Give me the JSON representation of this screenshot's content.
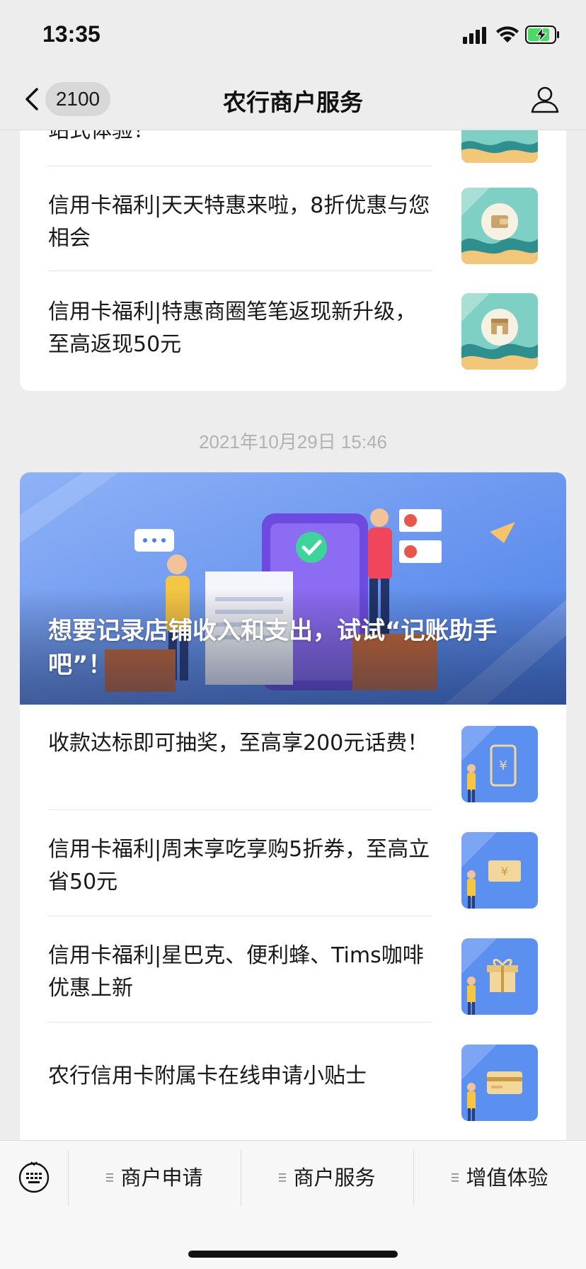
{
  "status_bar": {
    "time": "13:35"
  },
  "nav": {
    "unread_count": "2100",
    "title": "农行商户服务"
  },
  "top_card": {
    "partial_text": "站式体验！",
    "items": [
      {
        "title": "信用卡福利|天天特惠来啦，8折优惠与您相会",
        "thumb_icon": "wallet-icon"
      },
      {
        "title": "信用卡福利|特惠商圈笔笔返现新升级，至高返现50元",
        "thumb_icon": "shop-icon"
      }
    ]
  },
  "timestamp": "2021年10月29日 15:46",
  "article_card": {
    "hero_title": "想要记录店铺收入和支出，试试“记账助手吧”！",
    "items": [
      {
        "title": "收款达标即可抽奖，至高享200元话费！",
        "thumb_icon": "phone-yuan-icon"
      },
      {
        "title": "信用卡福利|周末享吃享购5折券，至高立省50元",
        "thumb_icon": "coupon-icon"
      },
      {
        "title": "信用卡福利|星巴克、便利蜂、Tims咖啡优惠上新",
        "thumb_icon": "gift-icon"
      },
      {
        "title": "农行信用卡附属卡在线申请小贴士",
        "thumb_icon": "card-icon"
      }
    ]
  },
  "menu": {
    "items": [
      {
        "label": "商户申请"
      },
      {
        "label": "商户服务"
      },
      {
        "label": "增值体验"
      }
    ]
  },
  "colors": {
    "hero_blue": "#5b8ff0",
    "teal_thumb": "#7ed0c4",
    "battery_green": "#4cd964"
  }
}
